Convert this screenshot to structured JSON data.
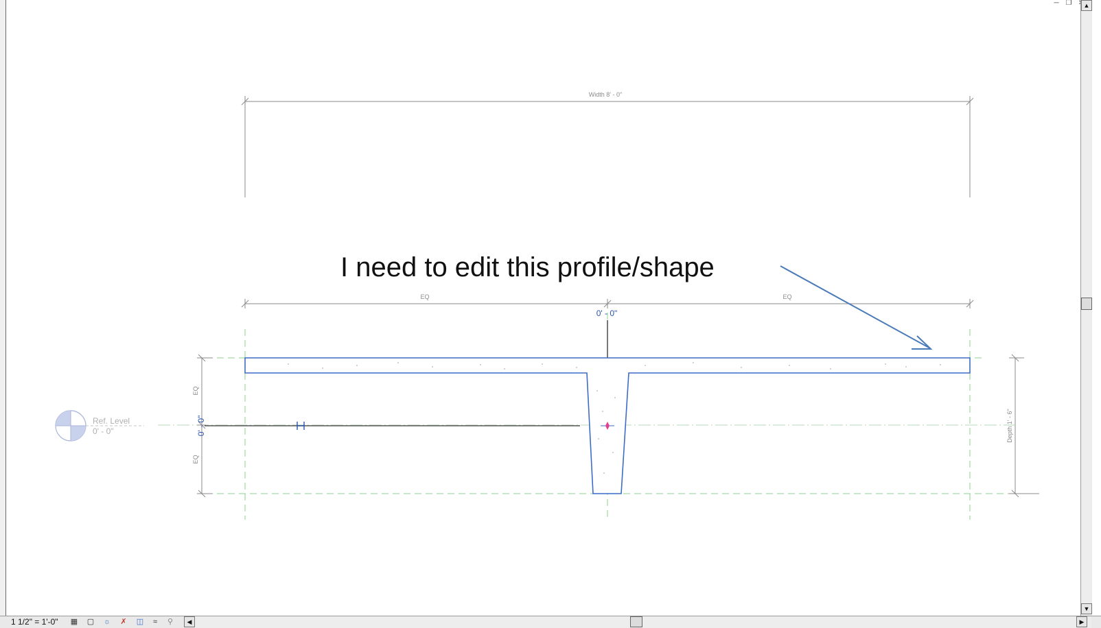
{
  "window": {
    "controls": [
      "minimize",
      "restore",
      "close"
    ]
  },
  "annotation": {
    "text": "I need to edit this profile/shape"
  },
  "dimensions": {
    "width": "Width  8' - 0\"",
    "eq_left": "EQ",
    "eq_right": "EQ",
    "eq_vertical_top": "EQ",
    "eq_vertical_bottom": "EQ",
    "depth": "Depth 1' - 6\"",
    "temp_horizontal": "0' - 0\"",
    "temp_vertical": "0' - 0\""
  },
  "level": {
    "name": "Ref. Level",
    "elevation": "0' - 0\""
  },
  "statusbar": {
    "scale": "1 1/2\" = 1'-0\"",
    "icons": [
      "detail-level-icon",
      "visual-style-icon",
      "sun-path-icon",
      "shadows-icon",
      "crop-view-icon",
      "show-crop-icon",
      "temporary-hide-icon",
      "reveal-hidden-icon"
    ]
  },
  "colors": {
    "profile": "#3d6bc6",
    "annotation_arrow": "#4a7ab8",
    "reference_plane": "#8fd18f",
    "dimension": "#8a8a8a",
    "origin_marker": "#e0428f"
  }
}
